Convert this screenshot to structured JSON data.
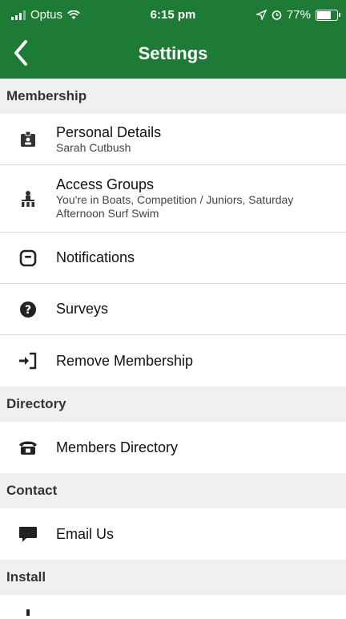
{
  "status_bar": {
    "carrier": "Optus",
    "time": "6:15 pm",
    "battery": "77%",
    "battery_level": 0.77
  },
  "header": {
    "title": "Settings",
    "back_icon": "chevron-left-icon"
  },
  "sections": [
    {
      "label": "Membership"
    },
    {
      "label": "Directory"
    },
    {
      "label": "Contact"
    },
    {
      "label": "Install"
    }
  ],
  "rows": {
    "personal_details": {
      "title": "Personal Details",
      "subtitle": "Sarah Cutbush",
      "icon": "id-badge-icon"
    },
    "access_groups": {
      "title": "Access Groups",
      "subtitle": "You're in Boats, Competition / Juniors, Saturday Afternoon Surf Swim",
      "icon": "sitemap-icon"
    },
    "notifications": {
      "title": "Notifications",
      "icon": "notification-icon"
    },
    "surveys": {
      "title": "Surveys",
      "icon": "question-circle-icon"
    },
    "remove_membership": {
      "title": "Remove Membership",
      "icon": "sign-in-icon"
    },
    "members_directory": {
      "title": "Members Directory",
      "icon": "phone-icon"
    },
    "email_us": {
      "title": "Email Us",
      "icon": "comment-icon"
    }
  }
}
